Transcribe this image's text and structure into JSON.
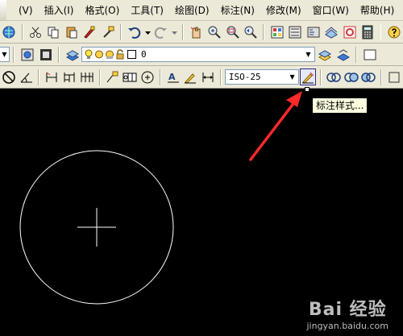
{
  "menu": {
    "items": [
      "(V)",
      "插入(I)",
      "格式(O)",
      "工具(T)",
      "绘图(D)",
      "标注(N)",
      "修改(M)",
      "窗口(W)",
      "帮助(H)"
    ]
  },
  "toolbar_layers": {
    "layer_value": "0"
  },
  "toolbar_dimension": {
    "dimstyle_value": "ISO-25"
  },
  "tooltip": {
    "text": "标注样式..."
  },
  "watermark": {
    "brand": "Bai 经验",
    "url": "jingyan.baidu.com"
  },
  "colors": {
    "annotation_arrow": "#ff2a2a",
    "toolbar_bg": "#ece9d8",
    "canvas_bg": "#000000",
    "geometry": "#ffffff"
  }
}
